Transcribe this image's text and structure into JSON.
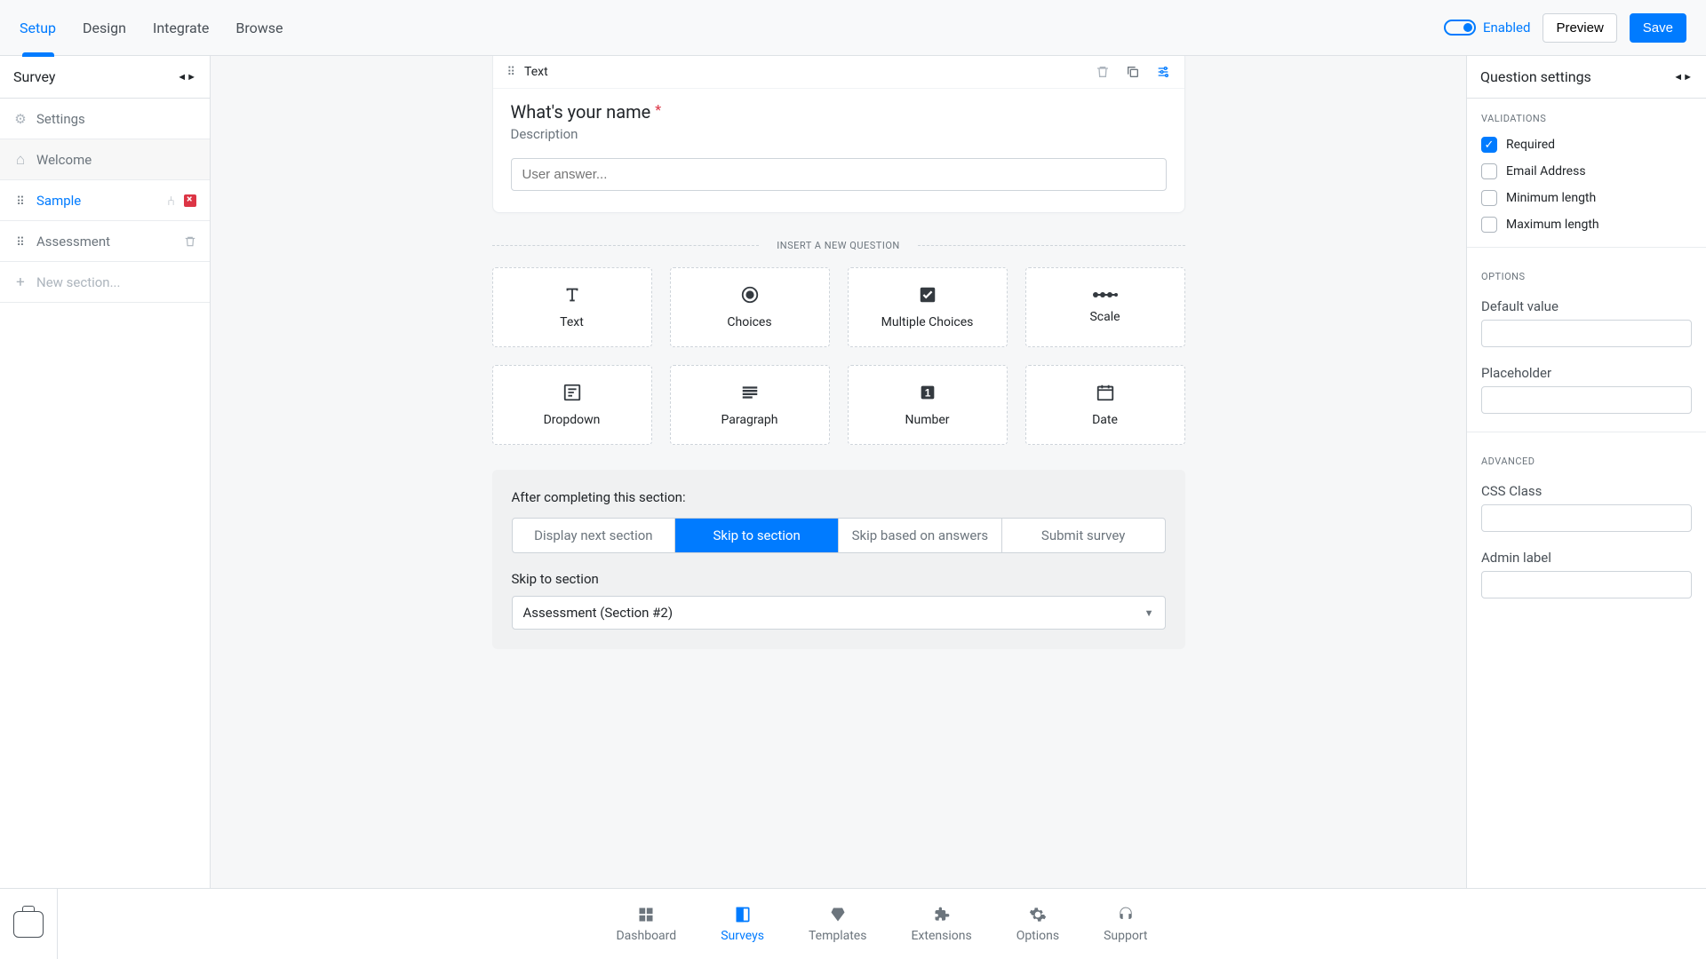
{
  "topnav": {
    "tabs": [
      "Setup",
      "Design",
      "Integrate",
      "Browse"
    ],
    "enabled_label": "Enabled",
    "preview": "Preview",
    "save": "Save"
  },
  "sidebar": {
    "title": "Survey",
    "items": {
      "settings": "Settings",
      "welcome": "Welcome",
      "sample": "Sample",
      "assessment": "Assessment",
      "new_section": "New section..."
    }
  },
  "question": {
    "type_label": "Text",
    "title": "What's your name",
    "description": "Description",
    "placeholder": "User answer..."
  },
  "insert_label": "INSERT A NEW QUESTION",
  "qtypes": {
    "text": "Text",
    "choices": "Choices",
    "multiple": "Multiple Choices",
    "scale": "Scale",
    "dropdown": "Dropdown",
    "paragraph": "Paragraph",
    "number": "Number",
    "date": "Date"
  },
  "after": {
    "label": "After completing this section:",
    "options": [
      "Display next section",
      "Skip to section",
      "Skip based on answers",
      "Submit survey"
    ],
    "skip_label": "Skip to section",
    "select_value": "Assessment (Section #2)"
  },
  "right": {
    "title": "Question settings",
    "validations_label": "VALIDATIONS",
    "required": "Required",
    "email": "Email Address",
    "minlen": "Minimum length",
    "maxlen": "Maximum length",
    "options_label": "OPTIONS",
    "default_value": "Default value",
    "placeholder": "Placeholder",
    "advanced_label": "ADVANCED",
    "css_class": "CSS Class",
    "admin_label": "Admin label"
  },
  "bottom": {
    "dashboard": "Dashboard",
    "surveys": "Surveys",
    "templates": "Templates",
    "extensions": "Extensions",
    "options": "Options",
    "support": "Support"
  }
}
